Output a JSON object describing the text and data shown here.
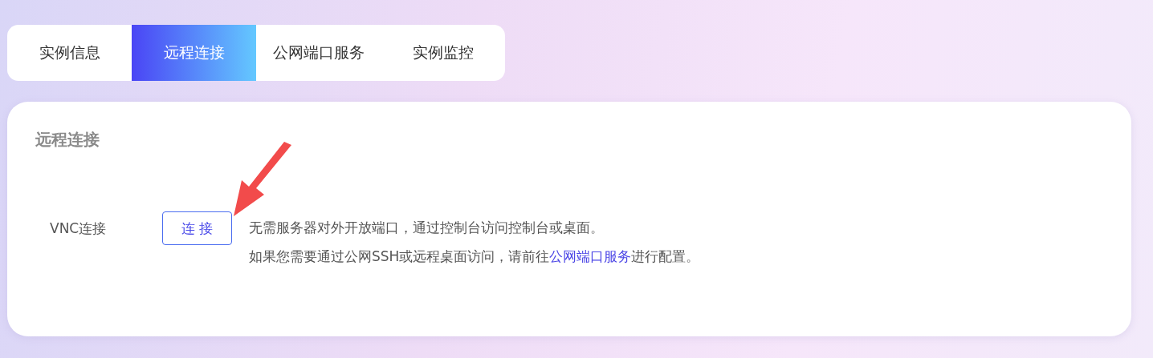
{
  "tabs": [
    {
      "label": "实例信息",
      "selected": false
    },
    {
      "label": "远程连接",
      "selected": true
    },
    {
      "label": "公网端口服务",
      "selected": false
    },
    {
      "label": "实例监控",
      "selected": false
    }
  ],
  "panel": {
    "title": "远程连接",
    "rows": [
      {
        "label": "VNC连接",
        "button": "连 接",
        "lines": [
          [
            {
              "kind": "text",
              "text": "无需服务器对外开放端口，通过控制台访问控制台或桌面。"
            }
          ],
          [
            {
              "kind": "text",
              "text": "如果您需要通过公网SSH或远程桌面访问，请前往"
            },
            {
              "kind": "link",
              "text": "公网端口服务"
            },
            {
              "kind": "text",
              "text": "进行配置。"
            }
          ]
        ]
      }
    ]
  }
}
